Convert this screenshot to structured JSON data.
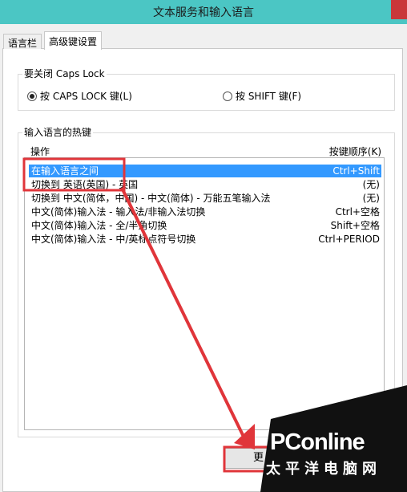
{
  "window": {
    "title": "文本服务和输入语言"
  },
  "tabs": [
    {
      "label": "语言栏"
    },
    {
      "label": "高级键设置"
    }
  ],
  "caps_group": {
    "legend": "要关闭 Caps Lock",
    "options": [
      {
        "label": "按 CAPS LOCK 键(L)",
        "checked": true
      },
      {
        "label": "按 SHIFT 键(F)",
        "checked": false
      }
    ]
  },
  "hotkeys_group": {
    "legend": "输入语言的热键",
    "columns": {
      "operation": "操作",
      "key_sequence": "按键顺序(K)"
    },
    "rows": [
      {
        "operation": "在输入语言之间",
        "keys": "Ctrl+Shift",
        "selected": true
      },
      {
        "operation": "切换到 英语(英国) - 英国",
        "keys": "(无)",
        "selected": false
      },
      {
        "operation": "切换到 中文(简体，中国) - 中文(简体) - 万能五笔输入法",
        "keys": "(无)",
        "selected": false
      },
      {
        "operation": "中文(简体)输入法 - 输入法/非输入法切换",
        "keys": "Ctrl+空格",
        "selected": false
      },
      {
        "operation": "中文(简体)输入法 - 全/半角切换",
        "keys": "Shift+空格",
        "selected": false
      },
      {
        "operation": "中文(简体)输入法 - 中/英标点符号切换",
        "keys": "Ctrl+PERIOD",
        "selected": false
      }
    ]
  },
  "buttons": {
    "change_key_sequence": "更"
  },
  "watermark": {
    "logo": "PConline",
    "sub": "太平洋电脑网"
  },
  "colors": {
    "titlebar": "#4bc6c4",
    "selection": "#3399ff",
    "annotation": "#e0353a",
    "close": "#c9373a"
  }
}
